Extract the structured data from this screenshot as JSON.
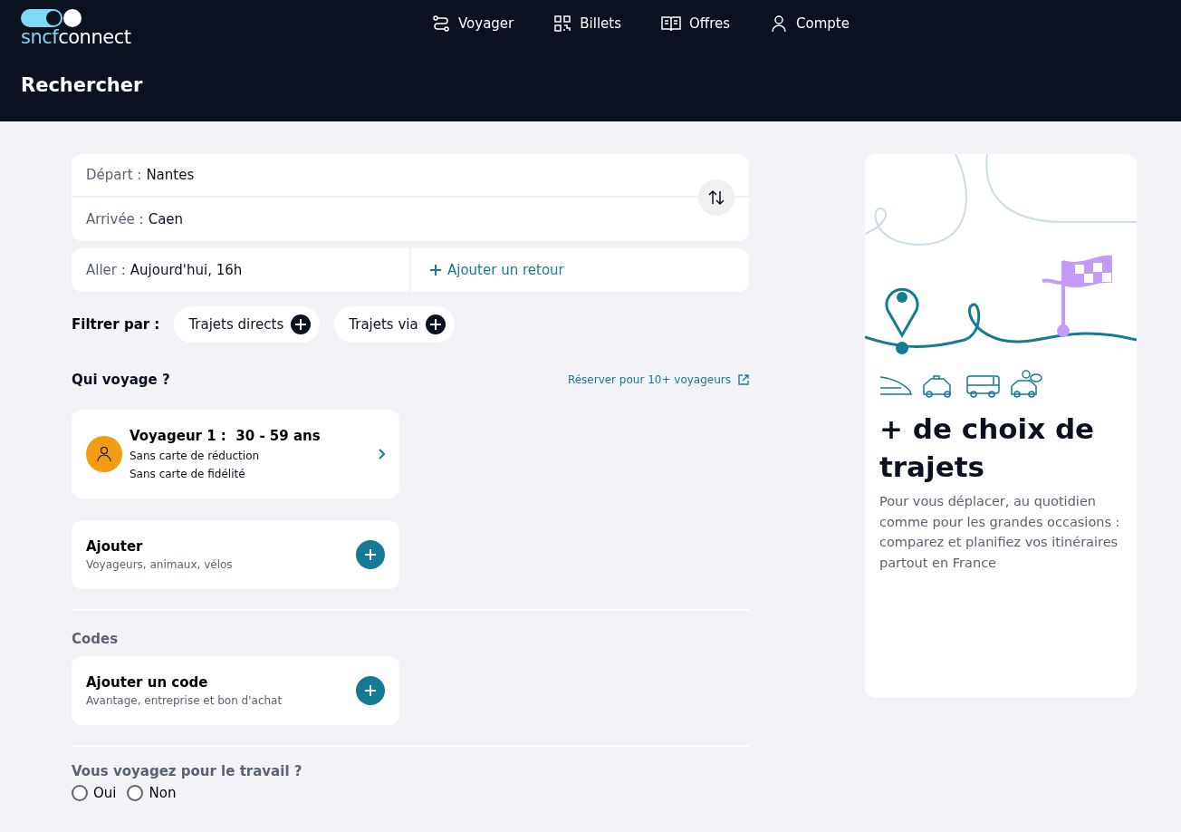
{
  "header": {
    "logo": [
      "sncf",
      "connect"
    ],
    "nav": [
      {
        "label": "Voyager"
      },
      {
        "label": "Billets"
      },
      {
        "label": "Offres"
      },
      {
        "label": "Compte"
      }
    ],
    "title": "Rechercher"
  },
  "search": {
    "departure": {
      "label": "Départ :",
      "value": "Nantes"
    },
    "arrival": {
      "label": "Arrivée :",
      "value": "Caen"
    },
    "outbound": {
      "label": "Aller :",
      "value": "Aujourd'hui, 16h"
    },
    "return_link": "Ajouter un retour"
  },
  "filters": {
    "label": "Filtrer par :",
    "chips": [
      "Trajets directs",
      "Trajets via"
    ]
  },
  "travellers": {
    "heading": "Qui voyage ?",
    "group_link": "Réserver pour 10+ voyageurs",
    "traveller": {
      "name": "Voyageur 1 :",
      "age": "30 - 59 ans",
      "lines": [
        "Sans carte de réduction",
        "Sans carte de fidélité"
      ]
    },
    "add": {
      "title": "Ajouter",
      "subtitle": "Voyageurs, animaux, vélos"
    }
  },
  "codes": {
    "heading": "Codes",
    "add": {
      "title": "Ajouter un code",
      "subtitle": "Avantage, entreprise et bon d'achat"
    }
  },
  "work": {
    "question": "Vous voyagez pour le travail ?",
    "options": [
      {
        "label": "Oui",
        "selected": false
      },
      {
        "label": "Non",
        "selected": false
      }
    ]
  },
  "promo": {
    "title": "+ de choix de trajets",
    "text": "Pour vous déplacer, au quotidien comme pour les grandes occasions : comparez et planifiez vos itinéraires partout en France"
  }
}
